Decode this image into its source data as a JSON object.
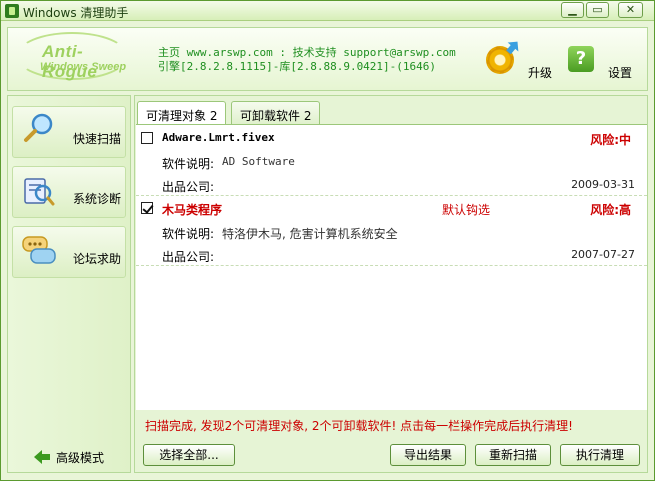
{
  "window": {
    "title": "Windows 清理助手",
    "controls": [
      "minimize-icon",
      "maximize-icon",
      "close-icon"
    ]
  },
  "header": {
    "logo_main": "Anti-Rogue",
    "logo_sub": "Windows Sweep",
    "info_line1": "主页 www.arswp.com : 技术支持 support@arswp.com",
    "info_line2": "引擎[2.8.2.8.1115]-库[2.8.88.9.0421]-(1646)",
    "upgrade_label": "升级",
    "settings_label": "设置"
  },
  "sidebar": {
    "items": [
      {
        "label": "快速扫描",
        "icon": "magnifier-icon"
      },
      {
        "label": "系统诊断",
        "icon": "diagnosis-icon"
      },
      {
        "label": "论坛求助",
        "icon": "chat-bubble-icon"
      }
    ],
    "advanced_label": "高级模式"
  },
  "tabs": [
    {
      "label": "可清理对象 2",
      "active": true
    },
    {
      "label": "可卸载软件 2",
      "active": false
    }
  ],
  "entries": [
    {
      "checked": false,
      "name": "Adware.Lmrt.fivex",
      "default_note": "",
      "risk": "风险:中",
      "desc_key": "软件说明:",
      "desc_value": "AD Software",
      "company_key": "出品公司:",
      "date": "2009-03-31"
    },
    {
      "checked": true,
      "name": "木马类程序",
      "default_note": "默认钩选",
      "risk": "风险:高",
      "desc_key": "软件说明:",
      "desc_value": "特洛伊木马, 危害计算机系统安全",
      "company_key": "出品公司:",
      "date": "2007-07-27"
    }
  ],
  "status_text": "扫描完成, 发现2个可清理对象, 2个可卸载软件! 点击每一栏操作完成后执行清理!",
  "buttons": {
    "select_all": "选择全部...",
    "export": "导出结果",
    "rescan": "重新扫描",
    "clean": "执行清理"
  },
  "colors": {
    "accent_green": "#5b9a2f",
    "risk_red": "#cc0000",
    "info_green": "#1f8f20"
  }
}
